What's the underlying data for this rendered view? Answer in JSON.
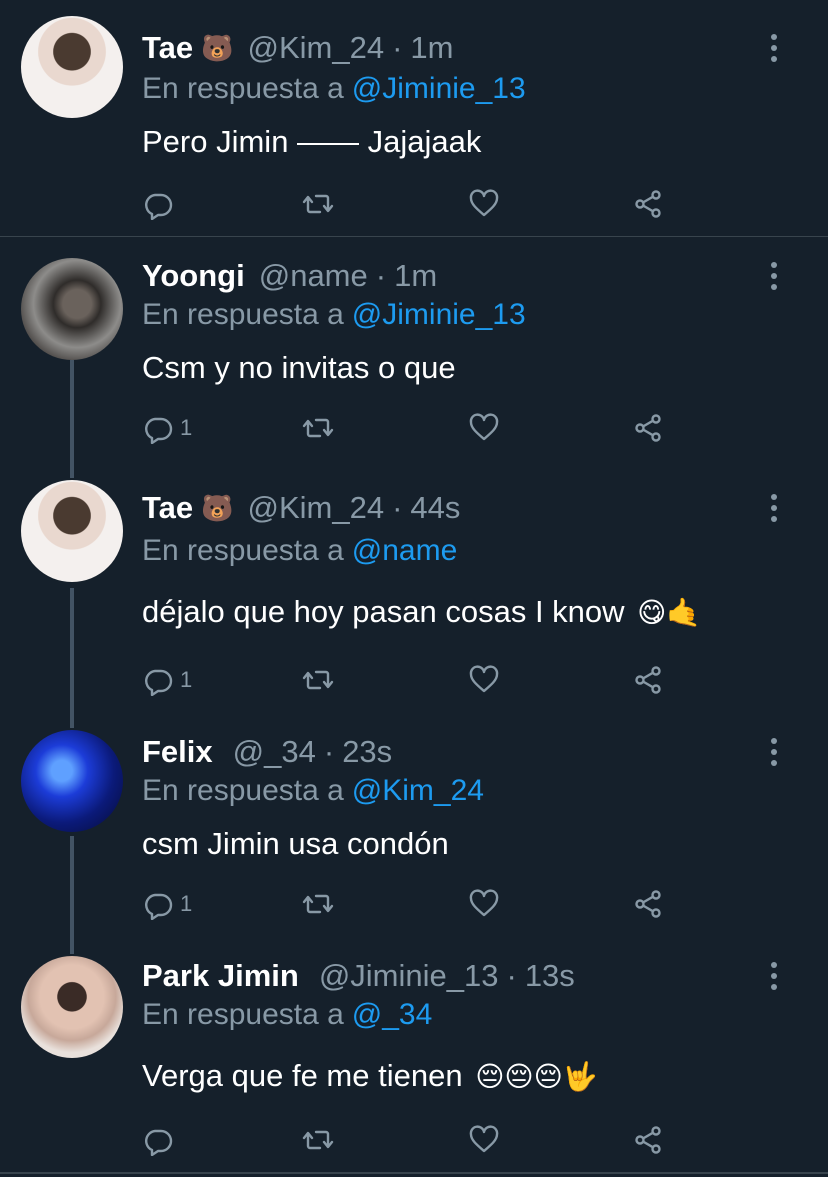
{
  "tweets": [
    {
      "name": "Tae",
      "badge": "🐻",
      "handle": "@Kim_24",
      "time": "1m",
      "reply_prefix": "En respuesta a",
      "reply_to": "@Jiminie_13",
      "text": "Pero Jimin —— Jajajaak",
      "emoji": "",
      "reply_count": "",
      "avatar": "tae-avatar"
    },
    {
      "name": "Yoongi",
      "badge": "",
      "handle": "@name",
      "time": "1m",
      "reply_prefix": "En respuesta a",
      "reply_to": "@Jiminie_13",
      "text": "Csm y no invitas o que",
      "emoji": "",
      "reply_count": "1",
      "avatar": "yoongi-avatar"
    },
    {
      "name": "Tae",
      "badge": "🐻",
      "handle": "@Kim_24",
      "time": "44s",
      "reply_prefix": "En respuesta a",
      "reply_to": "@name",
      "text": "déjalo que hoy pasan cosas I know",
      "emoji": "😋🤙",
      "reply_count": "1",
      "avatar": "tae-avatar"
    },
    {
      "name": "Felix",
      "badge": "",
      "handle": "@_34",
      "time": "23s",
      "reply_prefix": "En respuesta a",
      "reply_to": "@Kim_24",
      "text": "csm Jimin usa condón",
      "emoji": "",
      "reply_count": "1",
      "avatar": "felix-avatar"
    },
    {
      "name": "Park Jimin",
      "badge": "",
      "handle": "@Jiminie_13",
      "time": "13s",
      "reply_prefix": "En respuesta a",
      "reply_to": "@_34",
      "text": "Verga que fe me tienen",
      "emoji": "😔😔😔🤟",
      "reply_count": "",
      "avatar": "jimin-avatar"
    }
  ],
  "separator": "·",
  "icons": {
    "reply": "reply-icon",
    "retweet": "retweet-icon",
    "like": "like-icon",
    "share": "share-icon",
    "more": "more-icon"
  },
  "colors": {
    "background": "#15202b",
    "secondary_text": "#8899a6",
    "link": "#1d9bf0",
    "thread_line": "#425364"
  }
}
